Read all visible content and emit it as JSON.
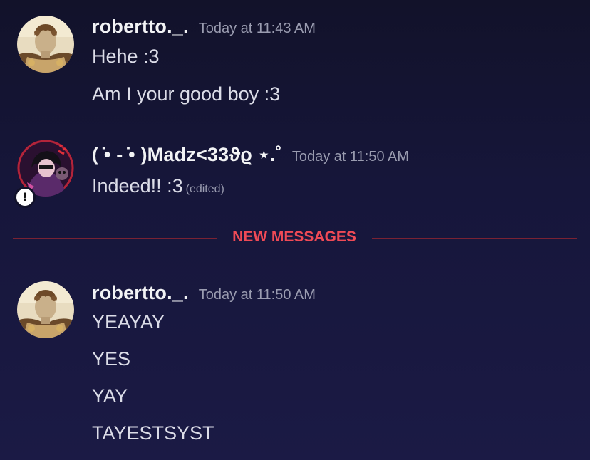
{
  "messages": [
    {
      "username": "robertto._.",
      "timestamp": "Today at 11:43 AM",
      "lines": [
        "Hehe :3",
        "Am I your good boy :3"
      ]
    },
    {
      "username": "( ̇• - ̇• )Madz<33ϑϱ ⋆.˚",
      "timestamp": "Today at 11:50 AM",
      "lines": [
        "Indeed!! :3"
      ],
      "edited_label": "(edited)",
      "status_badge": "!"
    },
    {
      "username": "robertto._.",
      "timestamp": "Today at 11:50 AM",
      "lines": [
        "YEAYAY",
        "YES",
        "YAY",
        "TAYESTSYST"
      ]
    }
  ],
  "divider": {
    "label": "NEW MESSAGES"
  },
  "colors": {
    "background_top": "#12122a",
    "background_bottom": "#1b1a45",
    "divider_accent": "#f04a56",
    "divider_line": "#7a2233",
    "username": "#f2f3f5",
    "timestamp": "#9a9cb0",
    "message_text": "#dcdde8"
  },
  "icons": {
    "avatar_robertto": "classical-statue-avatar",
    "avatar_madz": "anime-character-avatar",
    "status_badge": "exclamation-badge-icon"
  }
}
